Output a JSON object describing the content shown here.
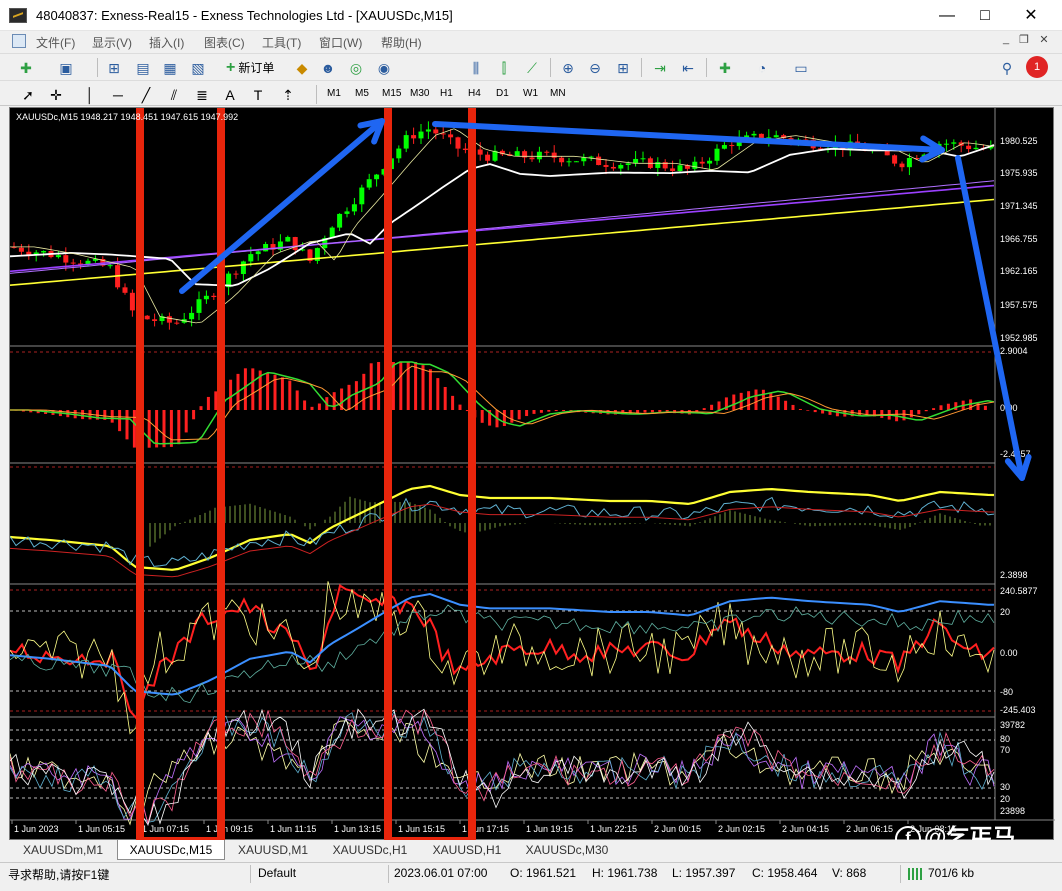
{
  "window": {
    "title": "48040837: Exness-Real15 - Exness Technologies Ltd - [XAUUSDc,M15]",
    "minimize": "—",
    "maximize": "□",
    "close": "✕"
  },
  "menu": {
    "items": [
      "文件(F)",
      "显示(V)",
      "插入(I)",
      "图表(C)",
      "工具(T)",
      "窗口(W)",
      "帮助(H)"
    ],
    "mdi": [
      "_",
      "❐",
      "✕"
    ]
  },
  "toolbar": {
    "new_order_label": "新订单",
    "notification_count": "1"
  },
  "timeframes": [
    "M1",
    "M5",
    "M15",
    "M30",
    "H1",
    "H4",
    "D1",
    "W1",
    "MN"
  ],
  "chart": {
    "header": "XAUUSDc,M15  1948.217 1948.451 1947.615 1947.992",
    "price_labels": [
      "1980.525",
      "1975.935",
      "1971.345",
      "1966.755",
      "1962.165",
      "1957.575",
      "1952.985"
    ],
    "ind1_labels": [
      "2.9004",
      "0.00",
      "-2.4257"
    ],
    "ind2_labels": [
      "2.3898"
    ],
    "ind3_labels": [
      "240.5877",
      "20",
      "0.00",
      "-80",
      "-245.403"
    ],
    "ind4_labels": [
      "39782",
      "80",
      "70",
      "30",
      "20",
      "23898"
    ],
    "time_labels": [
      "1 Jun 2023",
      "1 Jun 05:15",
      "1 Jun 07:15",
      "1 Jun 09:15",
      "1 Jun 11:15",
      "1 Jun 13:15",
      "1 Jun 15:15",
      "1 Jun 17:15",
      "1 Jun 19:15",
      "1 Jun 22:15",
      "2 Jun 00:15",
      "2 Jun 02:15",
      "2 Jun 04:15",
      "2 Jun 06:15",
      "2 Jun 08:15"
    ],
    "colors": {
      "bull": "#00ff00",
      "bear": "#ff2020",
      "annotation_box": "#e8250c",
      "annotation_arrow": "#1f66f2",
      "background": "#000000"
    }
  },
  "tabs": [
    "XAUUSDm,M1",
    "XAUUSDc,M15",
    "XAUUSD,M1",
    "XAUUSDc,H1",
    "XAUUSD,H1",
    "XAUUSDc,M30"
  ],
  "active_tab": 1,
  "status": {
    "help": "寻求帮助,请按F1键",
    "profile": "Default",
    "time": "2023.06.01 07:00",
    "open": "O: 1961.521",
    "high": "H: 1961.738",
    "low": "L: 1957.397",
    "close": "C: 1958.464",
    "volume": "V: 868",
    "traffic": "701/6 kb"
  },
  "watermark": "@乞丐马"
}
